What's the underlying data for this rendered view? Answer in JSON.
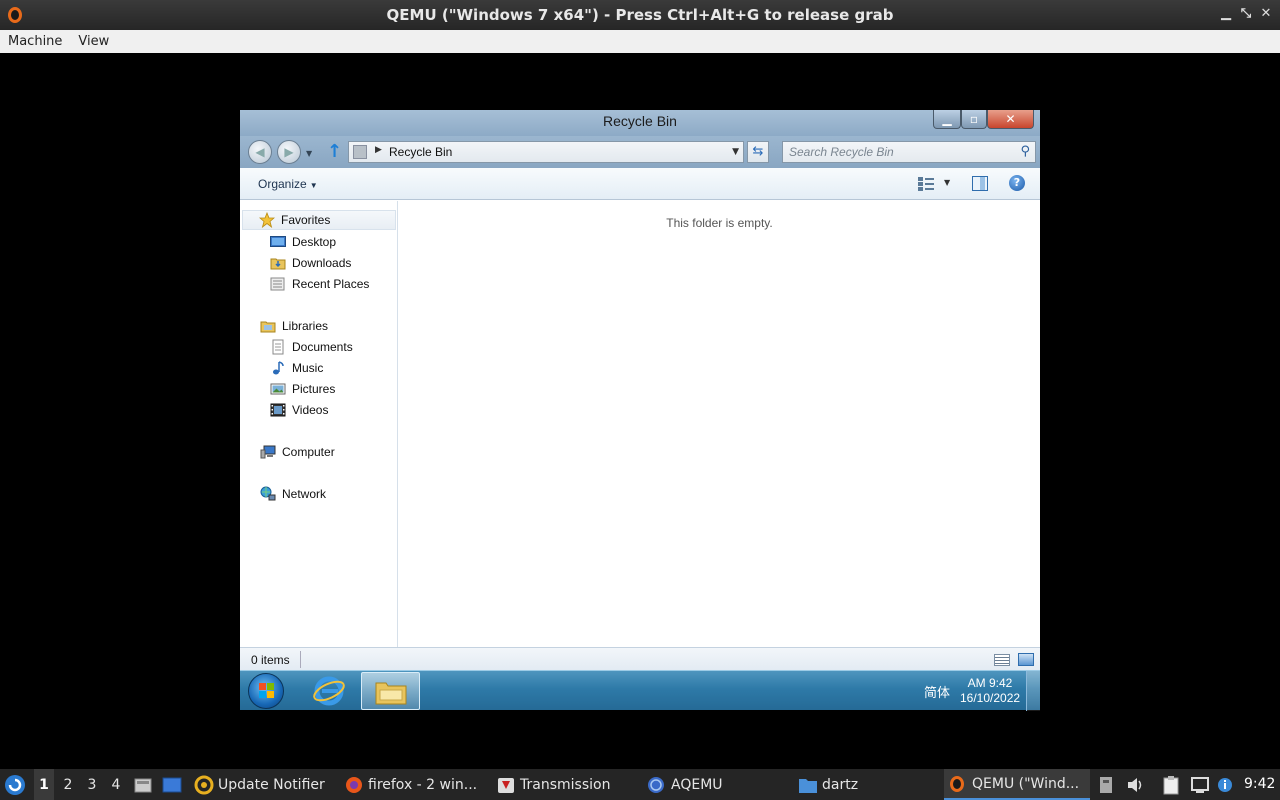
{
  "host": {
    "title": "QEMU (\"Windows 7 x64\") - Press Ctrl+Alt+G to release grab",
    "menu": [
      "Machine",
      "View"
    ],
    "window_controls": [
      "minimize",
      "restore",
      "close"
    ]
  },
  "explorer": {
    "window_title": "Recycle Bin",
    "address": {
      "location": "Recycle Bin"
    },
    "search": {
      "placeholder": "Search Recycle Bin"
    },
    "command_bar": {
      "organize_label": "Organize"
    },
    "nav_pane": {
      "favorites_label": "Favorites",
      "favorites": [
        "Desktop",
        "Downloads",
        "Recent Places"
      ],
      "libraries_label": "Libraries",
      "libraries": [
        "Documents",
        "Music",
        "Pictures",
        "Videos"
      ],
      "computer_label": "Computer",
      "network_label": "Network"
    },
    "empty_message": "This folder is empty.",
    "status": {
      "item_count": "0 items"
    }
  },
  "guest_taskbar": {
    "ime": "简体",
    "time": "AM 9:42",
    "date": "16/10/2022"
  },
  "host_panel": {
    "workspaces": [
      "1",
      "2",
      "3",
      "4"
    ],
    "active_workspace": "1",
    "tasks": {
      "update_notifier": "Update Notifier",
      "firefox": "firefox - 2 win...",
      "transmission": "Transmission",
      "aqemu": "AQEMU",
      "dartz": "dartz",
      "qemu": "QEMU (\"Wind..."
    },
    "clock": "9:42"
  },
  "colors": {
    "accent": "#4a90d9",
    "taskbar_blue": "#2e7aa8",
    "close_red": "#c8452d"
  }
}
